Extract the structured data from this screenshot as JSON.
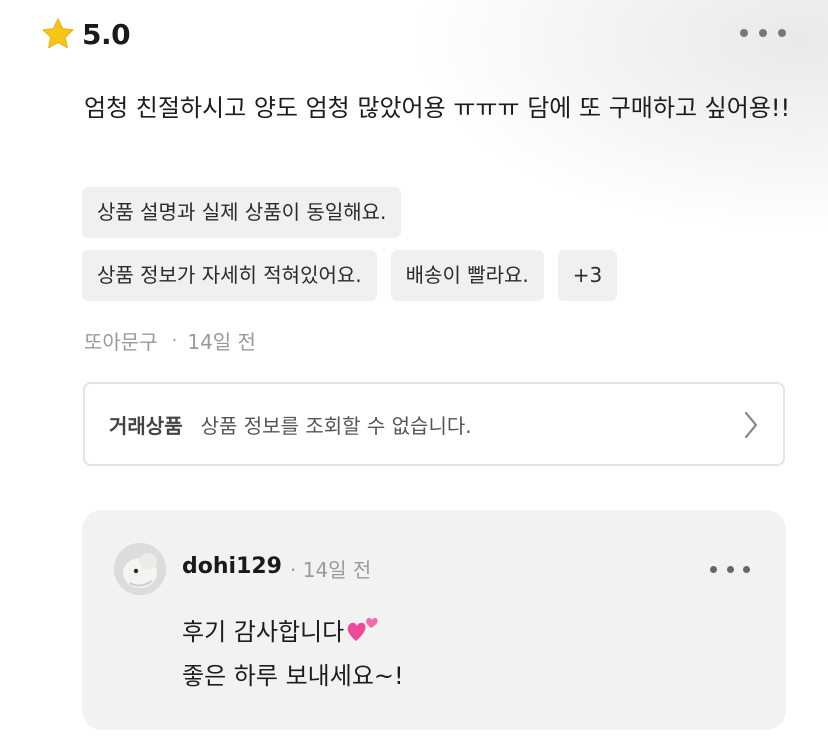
{
  "rating": {
    "value": "5.0",
    "icon": "star-icon",
    "star_color": "#F5C518"
  },
  "review": {
    "text": "엄청 친절하시고 양도 엄청 많았어용 ㅠㅠㅠ 담에 또 구매하고 싶어용!!",
    "tags_row1": [
      "상품 설명과 실제 상품이 동일해요."
    ],
    "tags_row2": [
      "상품 정보가 자세히 적혀있어요.",
      "배송이 빨라요.",
      "+3"
    ],
    "author": "또아문구",
    "time": "14일 전"
  },
  "product": {
    "label": "거래상품",
    "description": "상품 정보를 조회할 수 없습니다."
  },
  "reply": {
    "username": "dohi129",
    "time": "14일 전",
    "line1": "후기 감사합니다",
    "line2": "좋은 하루 보내세요~!",
    "emoji_icon": "two-hearts-icon",
    "heart_color": "#F0489A"
  }
}
